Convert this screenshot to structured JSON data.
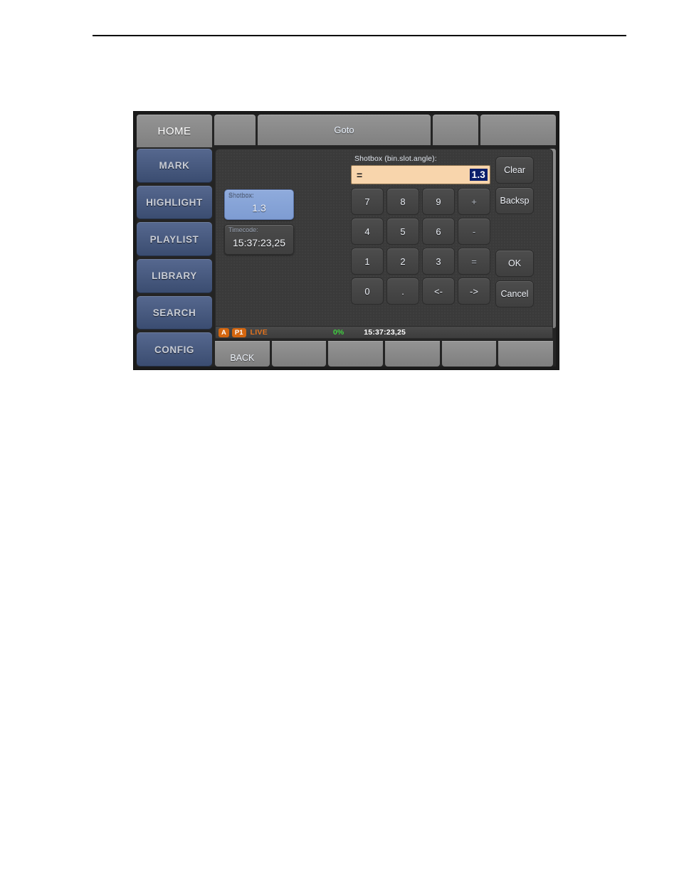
{
  "device": {
    "tabs": [
      {
        "label": "HOME",
        "type": "home",
        "active": true
      },
      {
        "label": "",
        "type": "blank-s",
        "active": false
      },
      {
        "label": "Goto",
        "type": "goto",
        "active": false
      },
      {
        "label": "",
        "type": "blank-m",
        "active": false
      },
      {
        "label": "",
        "type": "blank-e",
        "active": false
      }
    ],
    "sidebar": {
      "items": [
        {
          "label": "MARK"
        },
        {
          "label": "HIGHLIGHT"
        },
        {
          "label": "PLAYLIST"
        },
        {
          "label": "LIBRARY"
        },
        {
          "label": "SEARCH"
        },
        {
          "label": "CONFIG"
        }
      ]
    },
    "dialog": {
      "field_label": "Shotbox (bin.slot.angle):",
      "input": {
        "operator": "=",
        "value": "1.3",
        "selected": true,
        "background_color": "#f8d5ac",
        "selection_color": "#0a1f6b"
      },
      "info_boxes": [
        {
          "caption": "Shotbox:",
          "value": "1.3",
          "highlight": true,
          "color": "#8fabdc"
        },
        {
          "caption": "Timecode:",
          "value": "15:37:23,25",
          "highlight": false,
          "color": "#4b4b4b"
        }
      ],
      "keypad": [
        "7",
        "8",
        "9",
        "+",
        "4",
        "5",
        "6",
        "-",
        "1",
        "2",
        "3",
        "=",
        "0",
        ".",
        "<-",
        "->"
      ],
      "actions": [
        {
          "label": "Clear"
        },
        {
          "label": "Backsp"
        },
        {
          "label": "OK"
        },
        {
          "label": "Cancel"
        }
      ]
    },
    "statusbar": {
      "channel_badge": "A",
      "player_badge": "P1",
      "mode": "LIVE",
      "progress": "0%",
      "timecode": "15:37:23,25",
      "mode_color": "#e2721d",
      "progress_color": "#3fd13f"
    },
    "bottombar": {
      "buttons": [
        {
          "label": "BACK"
        },
        {
          "label": ""
        },
        {
          "label": ""
        },
        {
          "label": ""
        },
        {
          "label": ""
        },
        {
          "label": ""
        }
      ]
    }
  }
}
